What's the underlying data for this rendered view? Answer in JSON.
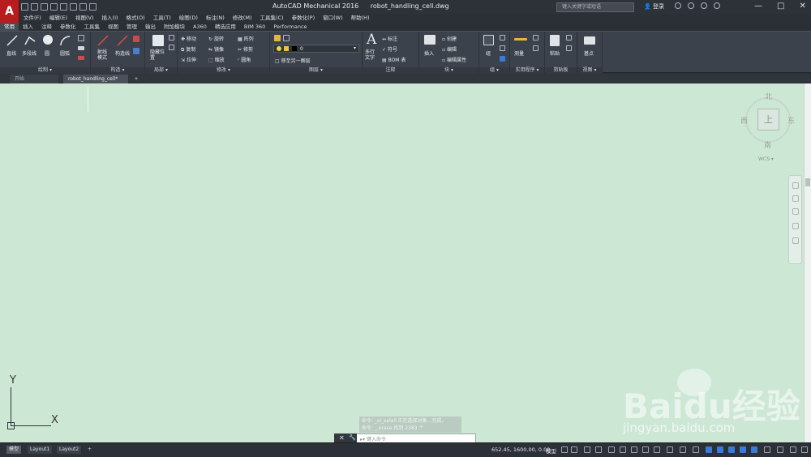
{
  "title": {
    "app": "AutoCAD Mechanical 2016",
    "file": "robot_handling_cell.dwg"
  },
  "search": {
    "placeholder": "键入关键字或短语"
  },
  "user": {
    "login": "登录"
  },
  "window": {
    "min": "—",
    "max": "□",
    "close": "✕"
  },
  "menu": [
    "文件(F)",
    "编辑(E)",
    "视图(V)",
    "插入(I)",
    "格式(O)",
    "工具(T)",
    "绘图(D)",
    "标注(N)",
    "修改(M)",
    "工具集(C)",
    "参数化(P)",
    "窗口(W)",
    "帮助(H)"
  ],
  "ribbon_tabs": [
    "常用",
    "插入",
    "注释",
    "参数化",
    "工具集",
    "视图",
    "管理",
    "输出",
    "附加模块",
    "A360",
    "精选应用",
    "BIM 360",
    "Performance"
  ],
  "ribbon": {
    "draw": {
      "title": "绘制 ▾",
      "line": "直线",
      "polyline": "多段线",
      "circle": "圆",
      "arc": "圆弧"
    },
    "construct": {
      "title": "构造 ▾",
      "ray": "射线模式",
      "construct": "构造线"
    },
    "detail": {
      "title": "局部 ▾",
      "hide": "隐藏位置"
    },
    "modify": {
      "title": "修改 ▾",
      "move": "移动",
      "rotate": "旋转",
      "array": "阵列",
      "copy": "复制",
      "mirror": "镜像",
      "trim": "修剪",
      "stretch": "拉伸",
      "scale": "缩放",
      "fillet": "圆角"
    },
    "layers": {
      "title": "图层 ▾",
      "layer_value": "0",
      "move_to_layer": "移至另一图层"
    },
    "annotation": {
      "title": "注释",
      "mtext": "多行文字",
      "dimension": "标注",
      "symbol": "符号",
      "bom": "BOM 表"
    },
    "block": {
      "title": "块 ▾",
      "insert": "插入",
      "create": "创建",
      "edit": "编辑",
      "edit_attr": "编辑属性"
    },
    "group": {
      "title": "组 ▾",
      "group": "组"
    },
    "utilities": {
      "title": "实用程序 ▾",
      "measure": "测量"
    },
    "clipboard": {
      "title": "剪贴板",
      "paste": "粘贴"
    },
    "view": {
      "title": "视图 ▾",
      "base": "基点"
    }
  },
  "doc_tabs": {
    "start": "开始",
    "file": "robot_handling_cell*",
    "plus": "+"
  },
  "viewcube": {
    "north": "北",
    "south": "南",
    "west": "西",
    "east": "东",
    "top": "上",
    "wcs": "WCS ▾"
  },
  "ucs": {
    "x": "X",
    "y": "Y"
  },
  "command": {
    "history": [
      "命令: _ai_selall 正在选择对象...完成。",
      "命令: _.erase 找到 2383 个"
    ],
    "prompt": "键入命令"
  },
  "layout_tabs": {
    "model": "模型",
    "layout1": "Layout1",
    "layout2": "Layout2",
    "plus": "+"
  },
  "status": {
    "coords": "652.45, 1600.00, 0.00",
    "model": "模型"
  },
  "watermark": {
    "logo": "Baidu经验",
    "url": "jingyan.baidu.com"
  },
  "colors": {
    "canvas": "#cde7d5",
    "ui_dark": "#3c424b",
    "accent_red": "#b91c1c"
  }
}
